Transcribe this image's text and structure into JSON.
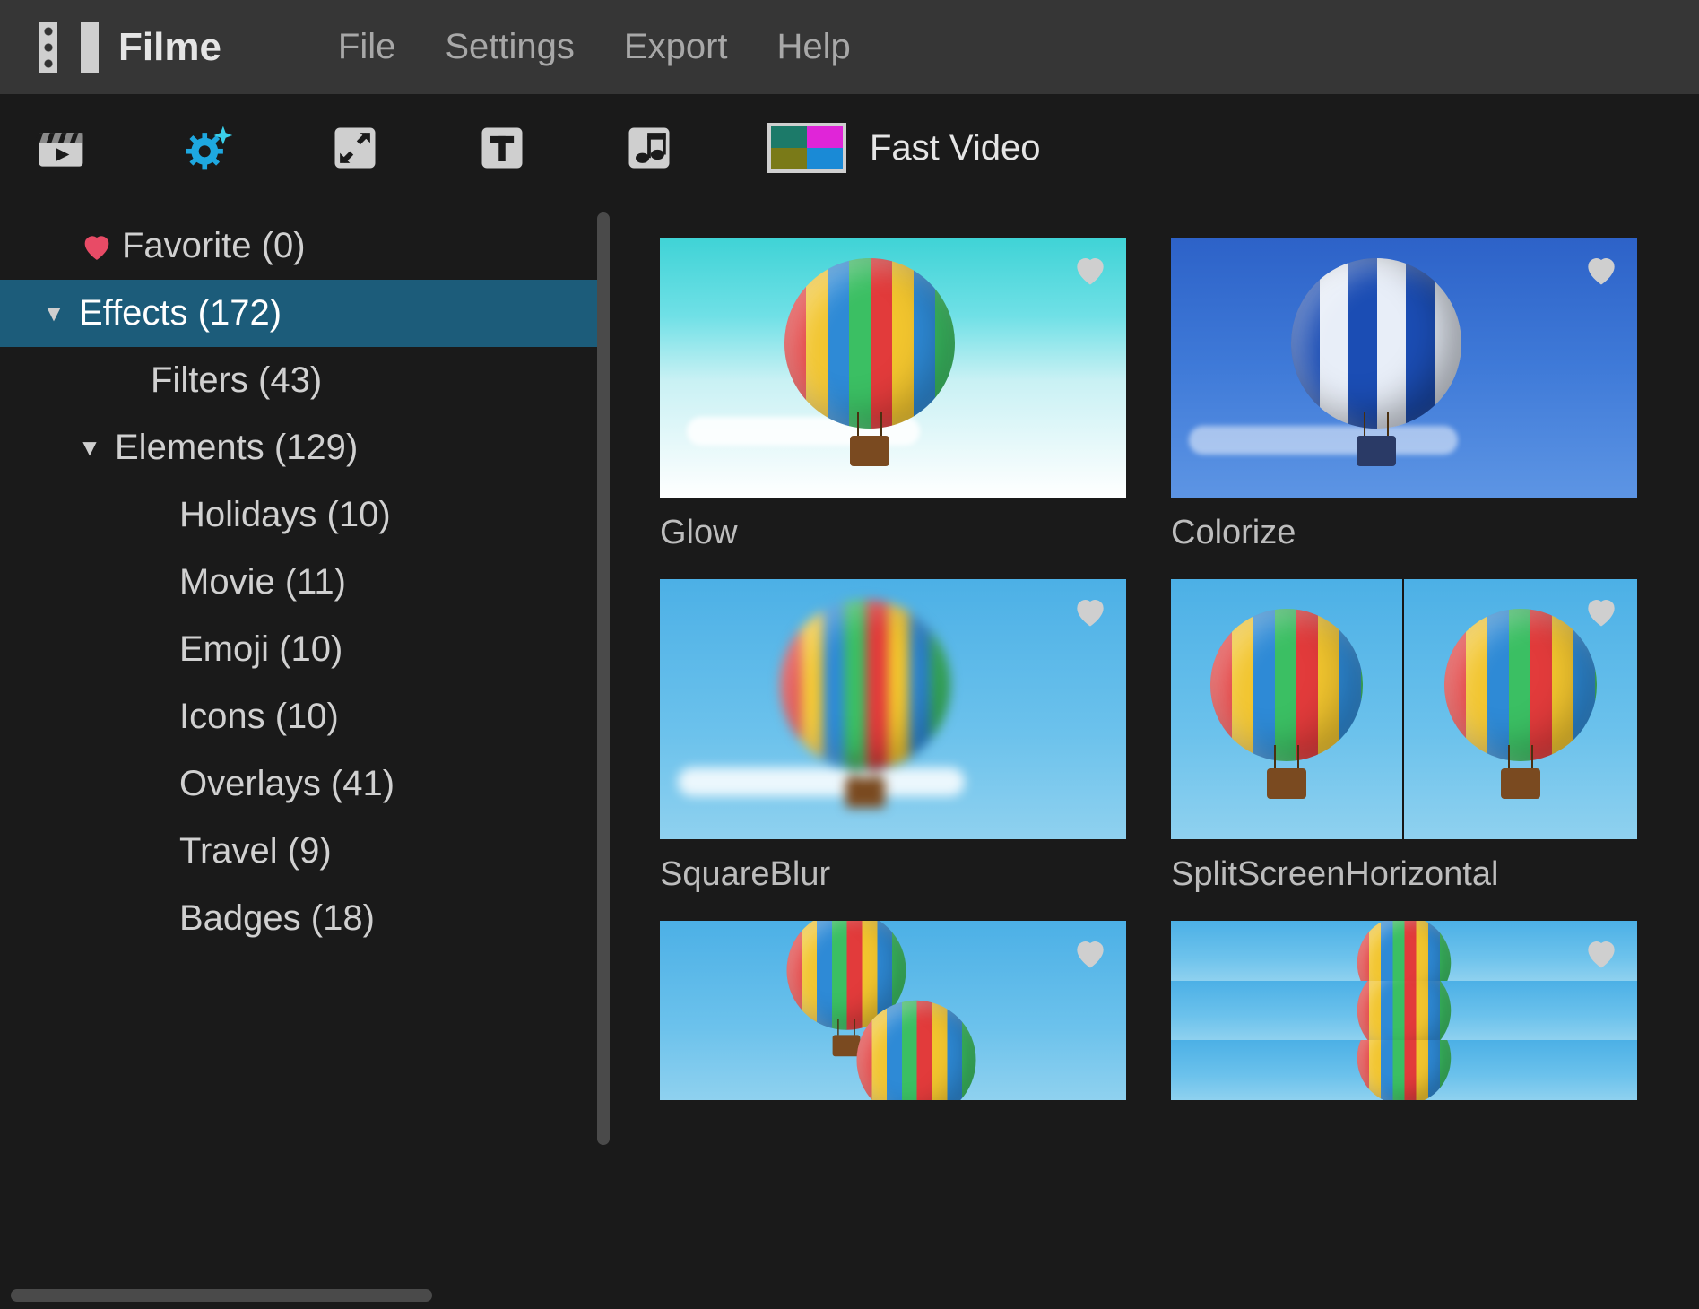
{
  "app": {
    "name": "Filme"
  },
  "menu": {
    "file": "File",
    "settings": "Settings",
    "export": "Export",
    "help": "Help"
  },
  "toolbar": {
    "fast_video": "Fast Video"
  },
  "sidebar": {
    "favorite": {
      "label": "Favorite",
      "count": 0
    },
    "effects": {
      "label": "Effects",
      "count": 172,
      "expanded": true,
      "selected": true
    },
    "filters": {
      "label": "Filters",
      "count": 43
    },
    "elements": {
      "label": "Elements",
      "count": 129,
      "expanded": true,
      "children": {
        "holidays": {
          "label": "Holidays",
          "count": 10
        },
        "movie": {
          "label": "Movie",
          "count": 11
        },
        "emoji": {
          "label": "Emoji",
          "count": 10
        },
        "icons": {
          "label": "Icons",
          "count": 10
        },
        "overlays": {
          "label": "Overlays",
          "count": 41
        },
        "travel": {
          "label": "Travel",
          "count": 9
        },
        "badges": {
          "label": "Badges",
          "count": 18
        }
      }
    }
  },
  "grid": {
    "items": [
      {
        "label": "Glow"
      },
      {
        "label": "Colorize"
      },
      {
        "label": "SquareBlur"
      },
      {
        "label": "SplitScreenHorizontal"
      },
      {
        "label": ""
      },
      {
        "label": ""
      }
    ]
  }
}
